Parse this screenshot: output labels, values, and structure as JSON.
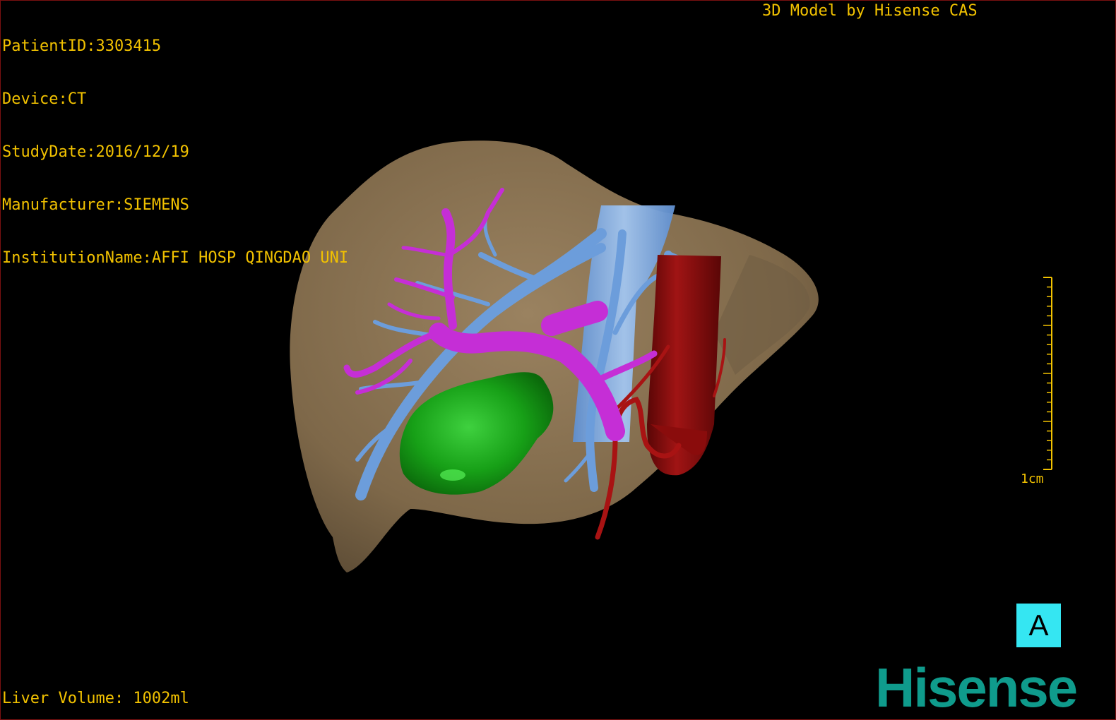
{
  "overlay": {
    "patient_id": "PatientID:3303415",
    "device": "Device:CT",
    "study_date": "StudyDate:2016/12/19",
    "manufacturer": "Manufacturer:SIEMENS",
    "institution": "InstitutionName:AFFI HOSP QINGDAO UNI",
    "credit": "3D Model by Hisense CAS",
    "liver_volume": "Liver Volume: 1002ml"
  },
  "scale": {
    "label": "1cm"
  },
  "orientation": {
    "label": "A"
  },
  "brand": {
    "logo_text": "Hisense"
  },
  "colors": {
    "overlay_text": "#f2c200",
    "liver": "#8a7354",
    "portal_vein": "#c02cd0",
    "hepatic_vein": "#6fa0dc",
    "ivc": "#7dace8",
    "aorta": "#8e0d0d",
    "hepatic_artery": "#b01515",
    "gallbladder_tumor": "#1c9a1c",
    "orientation_cube": "#35e6f2",
    "brand": "#0f9b8c",
    "border": "#7a1010"
  }
}
